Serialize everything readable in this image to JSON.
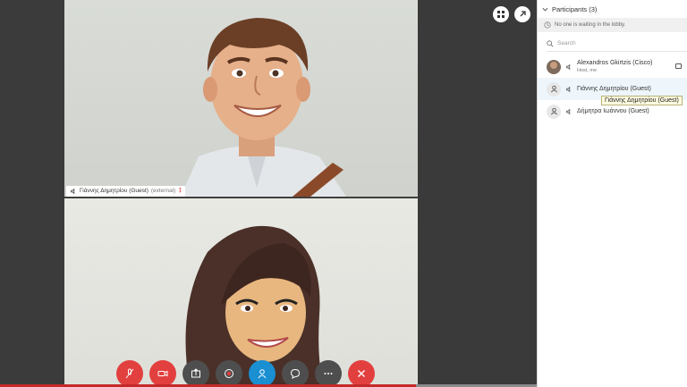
{
  "participants_panel": {
    "title": "Participants (3)",
    "lobby_message": "No one is waiting in the lobby.",
    "search_placeholder": "Search",
    "participants": [
      {
        "name": "Alexandros Gkirtzis (Cisco)",
        "subtitle": "Host, me"
      },
      {
        "name": "Γιάννης Δημητρίου (Guest)",
        "subtitle": ""
      },
      {
        "name": "Δήμητρα Ιωάννου (Guest)",
        "subtitle": ""
      }
    ],
    "tooltip": "Γιάννης Δημητρίου (Guest)"
  },
  "video": {
    "name_tag": "Γιάννης Δημητρίου (Guest)",
    "name_tag_suffix": "(external)"
  },
  "colors": {
    "red": "#e2403f",
    "blue": "#1a8fd1",
    "dark": "#4e4e4e"
  },
  "icons": {
    "mute": "microphone-muted-icon",
    "video": "video-off-icon",
    "share": "share-icon",
    "record": "record-icon",
    "participants": "participants-icon",
    "chat": "chat-icon",
    "more": "more-icon",
    "leave": "leave-icon"
  }
}
